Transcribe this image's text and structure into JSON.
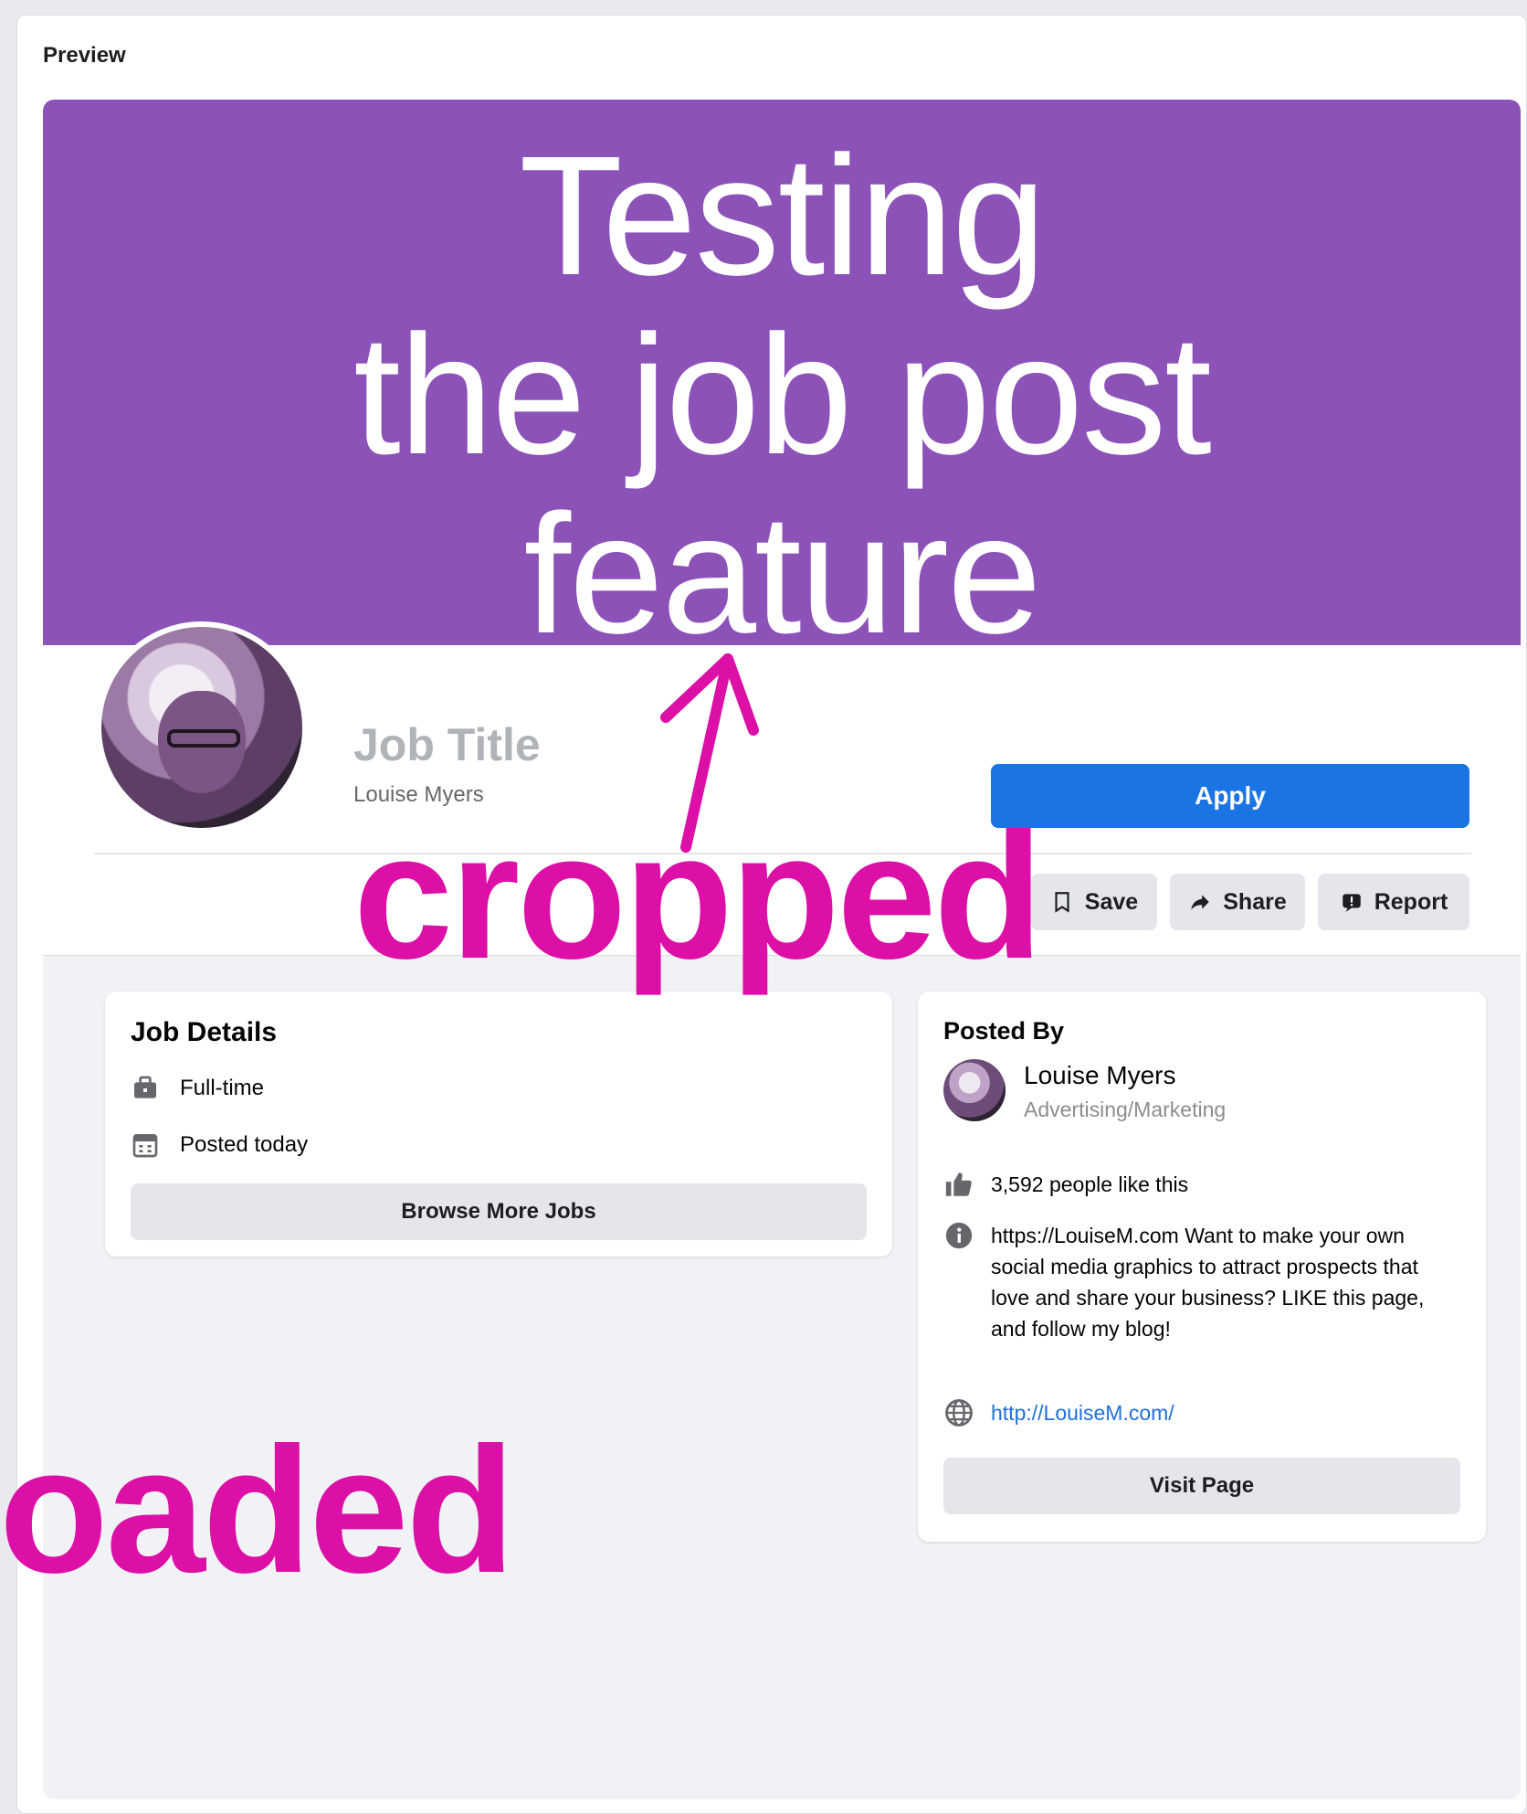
{
  "preview_label": "Preview",
  "cover": {
    "text": "Testing\nthe job post\nfeature",
    "color": "#8c52b8"
  },
  "header": {
    "job_title": "Job Title",
    "company": "Louise Myers",
    "apply_label": "Apply",
    "actions": [
      {
        "label": "Save",
        "icon": "bookmark-icon"
      },
      {
        "label": "Share",
        "icon": "share-icon"
      },
      {
        "label": "Report",
        "icon": "report-icon"
      }
    ],
    "accent": "#1b74e4"
  },
  "job_details": {
    "title": "Job Details",
    "items": [
      {
        "label": "Full-time",
        "icon": "briefcase-icon"
      },
      {
        "label": "Posted today",
        "icon": "calendar-icon"
      }
    ],
    "button_label": "Browse More Jobs"
  },
  "posted_by": {
    "title": "Posted By",
    "name": "Louise Myers",
    "category": "Advertising/Marketing",
    "likes": "3,592 people like this",
    "about": "https://LouiseM.com Want to make your own social media graphics to attract prospects that love and share your business? LIKE this page, and follow my blog!",
    "website": "http://LouiseM.com/",
    "button_label": "Visit Page"
  },
  "annotations": {
    "cropped": "cropped",
    "loaded": "oaded",
    "color": "#dc0fa6"
  }
}
